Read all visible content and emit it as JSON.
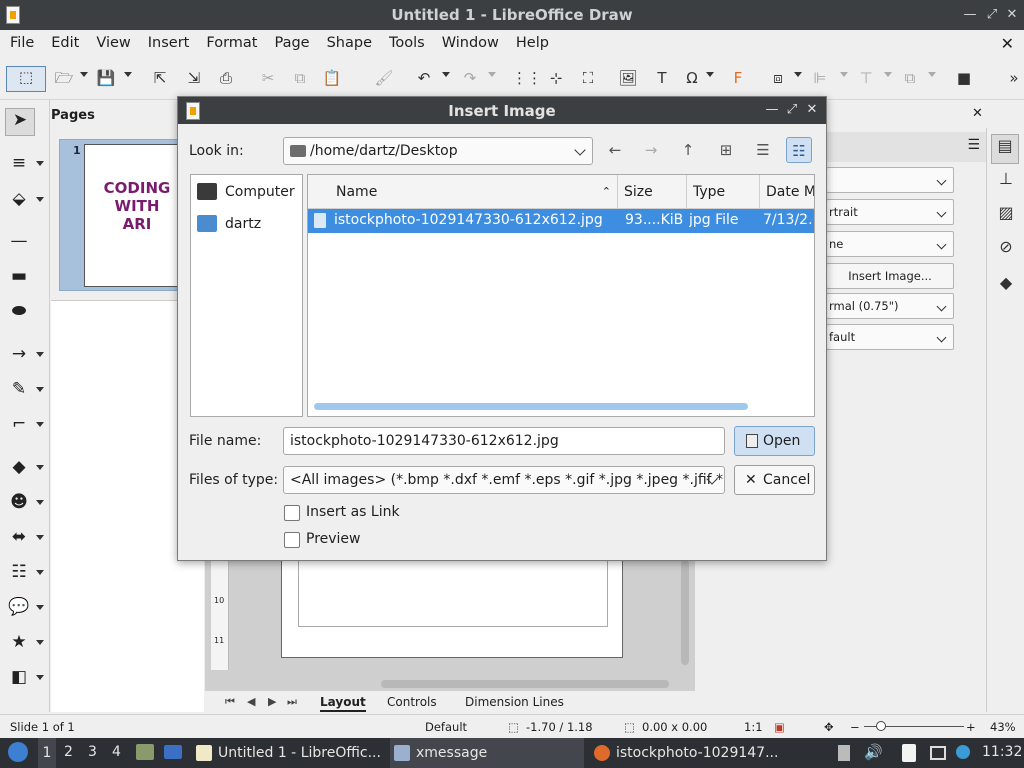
{
  "window": {
    "title": "Untitled 1 - LibreOffice Draw"
  },
  "menu": [
    "File",
    "Edit",
    "View",
    "Insert",
    "Format",
    "Page",
    "Shape",
    "Tools",
    "Window",
    "Help"
  ],
  "pages_panel": {
    "header": "Pages",
    "page_number": "1",
    "thumb_text": [
      "CODING",
      "WITH",
      "ARI"
    ]
  },
  "sidebar": {
    "options": [
      "",
      "rtrait",
      "ne",
      "rmal (0.75\")",
      "fault"
    ],
    "insert_image_label": "Insert Image..."
  },
  "tabs": {
    "layout": "Layout",
    "controls": "Controls",
    "dimension_lines": "Dimension Lines"
  },
  "ruler": [
    "10",
    "11"
  ],
  "statusbar": {
    "slide": "Slide 1 of 1",
    "style": "Default",
    "position": "-1.70 / 1.18",
    "size": "0.00 x 0.00",
    "scale": "1:1",
    "zoom": "43%"
  },
  "taskbar": {
    "workspaces": [
      "1",
      "2",
      "3",
      "4"
    ],
    "tasks": [
      "Untitled 1 - LibreOffic...",
      "xmessage",
      "istockphoto-1029147..."
    ],
    "clock": "11:32"
  },
  "dialog": {
    "title": "Insert Image",
    "look_in_label": "Look in:",
    "look_in_value": "/home/dartz/Desktop",
    "places": [
      "Computer",
      "dartz"
    ],
    "columns": {
      "name": "Name",
      "size": "Size",
      "type": "Type",
      "date": "Date M"
    },
    "file": {
      "name": "istockphoto-1029147330-612x612.jpg",
      "size": "93....KiB",
      "type": "jpg File",
      "date": "7/13/2."
    },
    "file_name_label": "File name:",
    "file_name_value": "istockphoto-1029147330-612x612.jpg",
    "files_of_type_label": "Files of type:",
    "files_of_type_value": "<All images> (*.bmp *.dxf *.emf *.eps *.gif *.jpg *.jpeg *.jfif *.j",
    "open_label": "Open",
    "cancel_label": "Cancel",
    "insert_as_link_label": "Insert as Link",
    "preview_label": "Preview"
  }
}
